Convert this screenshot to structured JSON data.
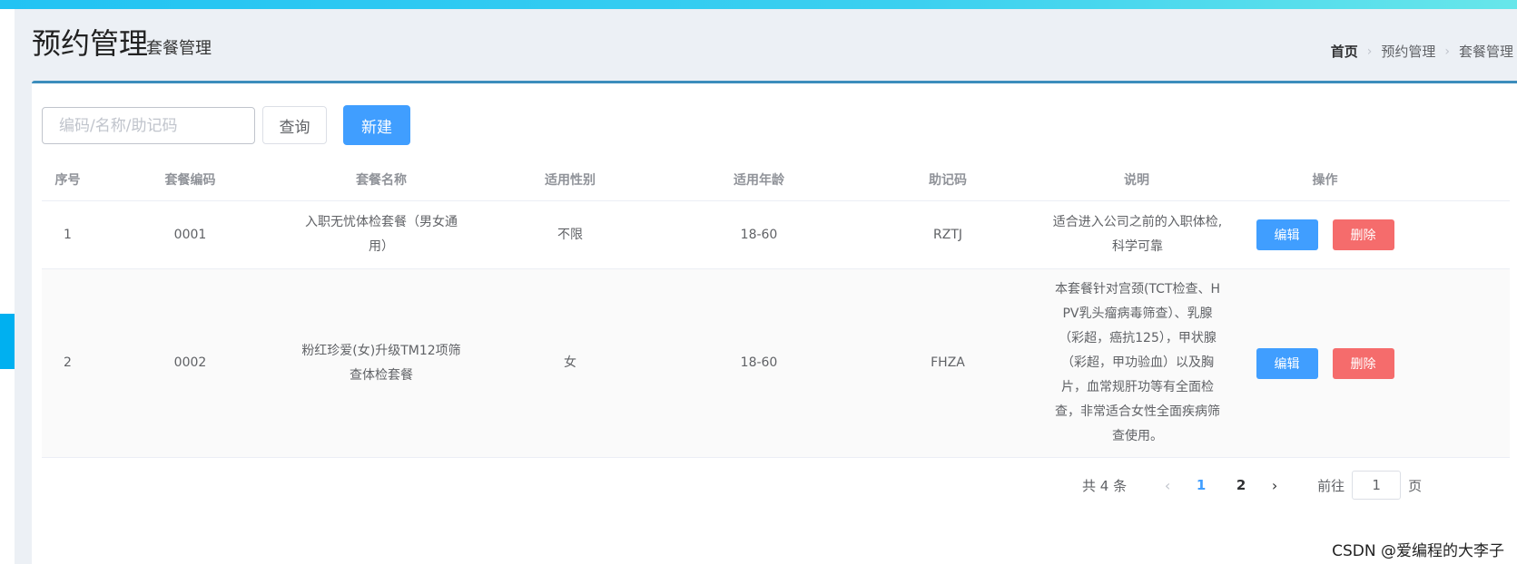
{
  "header": {
    "title": "预约管理",
    "subtitle": "套餐管理"
  },
  "breadcrumb": [
    "首页",
    "预约管理",
    "套餐管理"
  ],
  "toolbar": {
    "search_placeholder": "编码/名称/助记码",
    "search_value": "",
    "query_label": "查询",
    "new_label": "新建"
  },
  "table": {
    "columns": [
      "序号",
      "套餐编码",
      "套餐名称",
      "适用性别",
      "适用年龄",
      "助记码",
      "说明",
      "操作"
    ],
    "rows": [
      {
        "index": "1",
        "code": "0001",
        "name": "入职无忧体检套餐（男女通用）",
        "gender": "不限",
        "age": "18-60",
        "mnemonic": "RZTJ",
        "description": "适合进入公司之前的入职体检,科学可靠",
        "edit_label": "编辑",
        "delete_label": "删除"
      },
      {
        "index": "2",
        "code": "0002",
        "name": "粉红珍爱(女)升级TM12项筛查体检套餐",
        "gender": "女",
        "age": "18-60",
        "mnemonic": "FHZA",
        "description": "本套餐针对宫颈(TCT检查、HPV乳头瘤病毒筛查）、乳腺（彩超，癌抗125），甲状腺（彩超，甲功验血）以及胸片，血常规肝功等有全面检查，非常适合女性全面疾病筛查使用。",
        "edit_label": "编辑",
        "delete_label": "删除"
      }
    ]
  },
  "pagination": {
    "total_text": "共 4 条",
    "pages": [
      "1",
      "2"
    ],
    "current_page": "1",
    "jump_prefix": "前往",
    "jump_value": "1",
    "jump_suffix": "页"
  },
  "watermark": "CSDN @爱编程的大李子",
  "colors": {
    "primary": "#409eff",
    "danger": "#f56c6c",
    "panel_border": "#3c8dbc",
    "background": "#ecf0f5"
  }
}
